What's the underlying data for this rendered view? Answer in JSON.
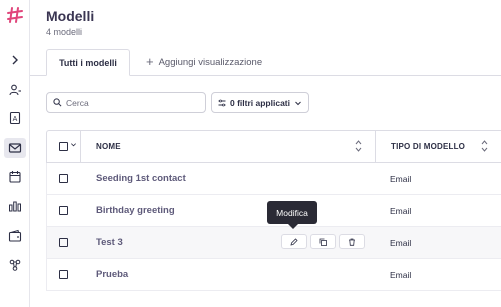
{
  "brand": {
    "accent": "#e0457b",
    "text": "#2d2f45"
  },
  "sidebar": {
    "items": [
      {
        "icon": "chevron-right-icon",
        "active": false
      },
      {
        "icon": "contacts-icon",
        "active": false
      },
      {
        "icon": "address-book-icon",
        "active": false
      },
      {
        "icon": "mail-icon",
        "active": true
      },
      {
        "icon": "calendar-icon",
        "active": false
      },
      {
        "icon": "bar-chart-icon",
        "active": false
      },
      {
        "icon": "wallet-icon",
        "active": false
      },
      {
        "icon": "integrations-icon",
        "active": false
      }
    ]
  },
  "header": {
    "title": "Modelli",
    "subtitle": "4 modelli"
  },
  "tabs": {
    "active_label": "Tutti i modelli",
    "add_label": "Aggiungi visualizzazione"
  },
  "toolbar": {
    "search_placeholder": "Cerca",
    "filter_label": "0 filtri applicati"
  },
  "table": {
    "columns": [
      "NOME",
      "TIPO DI MODELLO"
    ],
    "rows": [
      {
        "name": "Seeding 1st contact",
        "type": "Email"
      },
      {
        "name": "Birthday greeting",
        "type": "Email"
      },
      {
        "name": "Test 3",
        "type": "Email"
      },
      {
        "name": "Prueba",
        "type": "Email"
      }
    ]
  },
  "tooltip": {
    "label": "Modifica"
  }
}
